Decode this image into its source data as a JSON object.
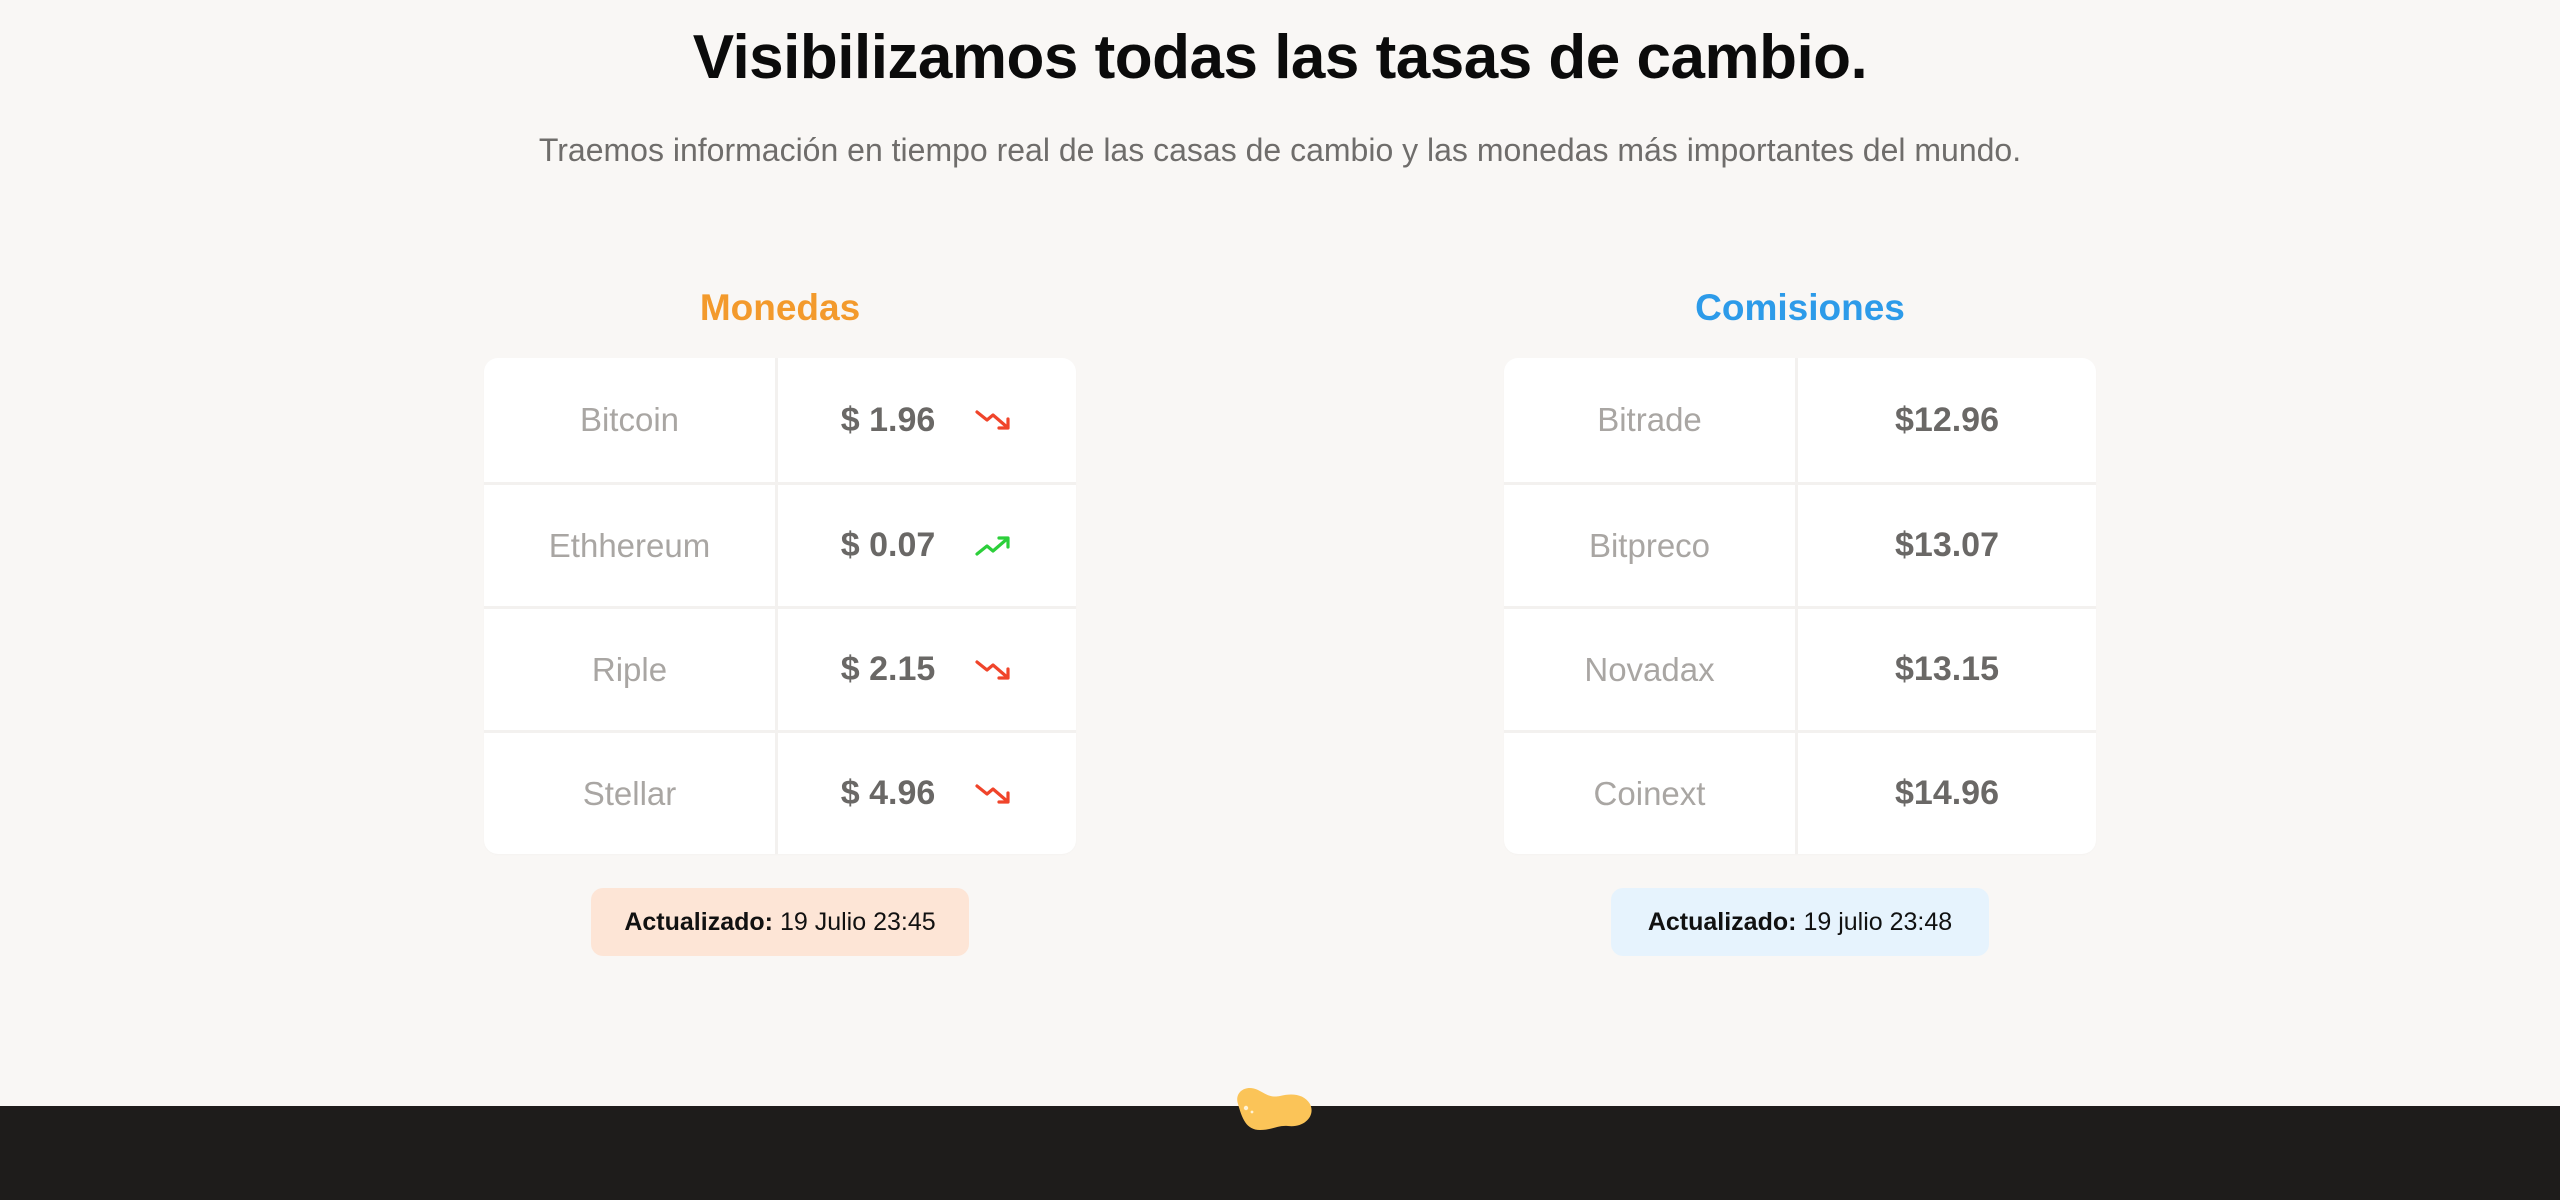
{
  "hero": {
    "title": "Visibilizamos todas las tasas de cambio.",
    "subtitle": "Traemos información en tiempo real de las casas de cambio y las monedas más importantes del mundo."
  },
  "colors": {
    "monedas_accent": "#f39a2c",
    "comisiones_accent": "#2d9be9",
    "trend_down": "#f0442a",
    "trend_up": "#2ccf3a",
    "monedas_badge_bg": "#fde5d6",
    "comisiones_badge_bg": "#e6f3fd",
    "footer_bg": "#1e1c1b",
    "blob": "#fbc458"
  },
  "monedas": {
    "title": "Monedas",
    "rows": [
      {
        "name": "Bitcoin",
        "value": "$ 1.96",
        "trend": "down",
        "trend_icon": "trend-down-icon"
      },
      {
        "name": "Ethhereum",
        "value": "$ 0.07",
        "trend": "up",
        "trend_icon": "trend-up-icon"
      },
      {
        "name": "Riple",
        "value": "$ 2.15",
        "trend": "down",
        "trend_icon": "trend-down-icon"
      },
      {
        "name": "Stellar",
        "value": "$ 4.96",
        "trend": "down",
        "trend_icon": "trend-down-icon"
      }
    ],
    "updated_label": "Actualizado:",
    "updated_value": "19 Julio 23:45"
  },
  "comisiones": {
    "title": "Comisiones",
    "rows": [
      {
        "name": "Bitrade",
        "value": "$12.96"
      },
      {
        "name": "Bitpreco",
        "value": "$13.07"
      },
      {
        "name": "Novadax",
        "value": "$13.15"
      },
      {
        "name": "Coinext",
        "value": "$14.96"
      }
    ],
    "updated_label": "Actualizado:",
    "updated_value": "19 julio 23:48"
  }
}
